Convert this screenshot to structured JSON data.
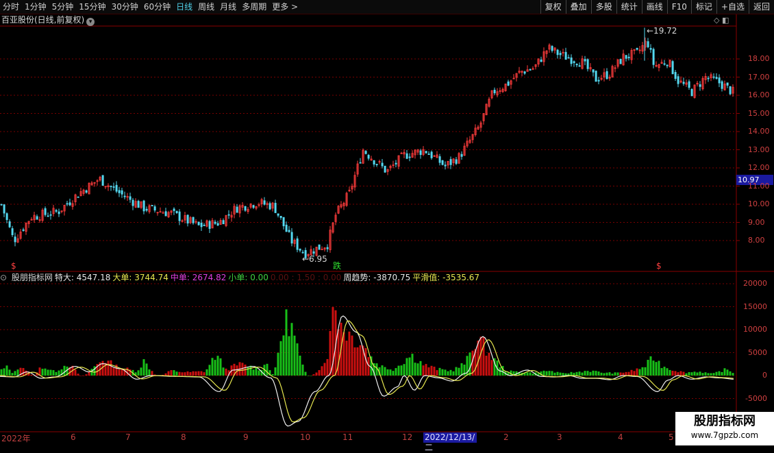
{
  "toolbar": {
    "periods": [
      "分时",
      "1分钟",
      "5分钟",
      "15分钟",
      "30分钟",
      "60分钟",
      "日线",
      "周线",
      "月线",
      "多周期",
      "更多"
    ],
    "active_period": "日线",
    "buttons": [
      "复权",
      "叠加",
      "多股",
      "统计",
      "画线",
      "F10",
      "标记",
      "+自选",
      "返回"
    ]
  },
  "stock": {
    "title": "百亚股份(日线,前复权)"
  },
  "price_axis": {
    "labels": [
      "18.00",
      "17.00",
      "16.00",
      "15.00",
      "14.00",
      "13.00",
      "12.00",
      "11.00",
      "10.00",
      "9.00",
      "8.00"
    ],
    "current": "10.97"
  },
  "annotations": {
    "high": "19.72",
    "low": "6.95",
    "signal": "跌",
    "marker": "$"
  },
  "indicator": {
    "name": "股朋指标网",
    "items": [
      {
        "label": "特大:",
        "value": "4547.18",
        "color": "#e8e8e8"
      },
      {
        "label": "大单:",
        "value": "3744.74",
        "color": "#e8e850"
      },
      {
        "label": "中单:",
        "value": "2674.82",
        "color": "#e040e0"
      },
      {
        "label": "小单:",
        "value": "0.00",
        "color": "#40d040"
      },
      {
        "label": "",
        "value": "0.00 : 1.50 : 0.00",
        "color": "#5a1010"
      },
      {
        "label": "周趋势:",
        "value": "-3870.75",
        "color": "#e8e8e8"
      },
      {
        "label": "平滑值:",
        "value": "-3535.67",
        "color": "#e8e850"
      }
    ],
    "axis_labels": [
      "20000",
      "15000",
      "10000",
      "5000",
      "0",
      "-5000"
    ]
  },
  "date_axis": {
    "ticks": [
      "2022年",
      "6",
      "7",
      "8",
      "9",
      "10",
      "11",
      "12",
      "2",
      "3",
      "4",
      "5"
    ],
    "highlight": "2022/12/13/二"
  },
  "watermark": {
    "title": "股朋指标网",
    "url": "www.7gpzb.com"
  },
  "colors": {
    "up": "#ff3c3c",
    "down": "#54d8f0",
    "bar_up": "#cc1010",
    "bar_down": "#18c018",
    "grid": "#7a0000"
  }
}
